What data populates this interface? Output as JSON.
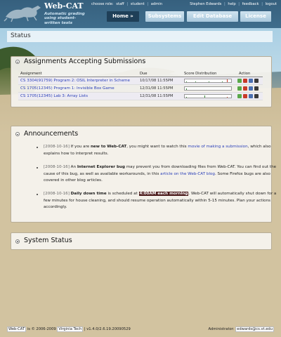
{
  "header": {
    "logo_text": "Web-CAT",
    "tagline": "Automatic grading using student-written tests",
    "role_label": "choose role:",
    "roles": [
      "staff",
      "student",
      "admin"
    ],
    "user_links": [
      "Stephen Edwards",
      "help",
      "feedback",
      "logout"
    ],
    "nav": [
      "Home »",
      "Subsystems",
      "Edit Database",
      "License"
    ]
  },
  "status": {
    "title": "Status"
  },
  "assignments": {
    "title": "Assignments Accepting Submissions",
    "columns": [
      "Assignment",
      "Due",
      "Score Distribution",
      "Action"
    ],
    "rows": [
      {
        "name": "CS 3304(91759) Program 2: OSIL Interpreter in Scheme",
        "due": "10/17/08 11:55PM",
        "distribution": [
          0.2,
          0.0,
          0.1,
          0.0,
          0.0,
          0.1,
          0.0,
          0.0,
          0.3,
          0.9
        ]
      },
      {
        "name": "CS 1705(12345) Program 1: Invisible Box Game",
        "due": "12/31/08 11:55PM",
        "distribution": [
          0.5,
          0.0,
          0.0,
          0.0,
          0.0,
          0.0,
          0.0,
          0.0,
          0.0,
          0.0
        ]
      },
      {
        "name": "CS 1705(12345) Lab 3: Array Lists",
        "due": "12/31/08 11:55PM",
        "distribution": [
          0.2,
          0.0,
          0.0,
          0.0,
          0.6,
          0.0,
          0.0,
          0.0,
          0.0,
          0.3
        ]
      }
    ],
    "action_icons": [
      "view-icon",
      "edit-icon",
      "graph-icon",
      "download-icon"
    ]
  },
  "announcements": {
    "title": "Announcements",
    "items": [
      {
        "date": "[2008-10-16]",
        "t1": " If you are ",
        "b1": "new to Web-CAT",
        "t2": ", you might want to watch this ",
        "link": "movie of making a submission",
        "t3": ", which also explains how to interpret results."
      },
      {
        "date": "[2008-10-16]",
        "t1": " An ",
        "b1": "Internet Explorer bug",
        "t2": " may prevent you from downloading files from Web-CAT. You can find out the cause of this bug, as well as available workarounds, in this ",
        "link": "article on the Web-CAT blog",
        "t3": ". Some Firefox bugs are also covered in other blog articles."
      },
      {
        "date": "[2008-10-16]",
        "b1": "Daily down time",
        "t2": " is scheduled at ",
        "hl": "4:00AM each morning",
        "t3": ". Web-CAT will automatically shut down for a few minutes for house cleaning, and should resume operation automatically within 5-15 minutes. Plan your actions accordingly."
      }
    ]
  },
  "system_status": {
    "title": "System Status"
  },
  "footer": {
    "app": "Web-CAT",
    "copyright": "is © 2006-2009",
    "institution": "Virginia Tech",
    "version": "v1.4.0/2.6.19.20090529",
    "admin_label": "Administrator:",
    "admin_email": "edwards@cs.vt.edu"
  }
}
